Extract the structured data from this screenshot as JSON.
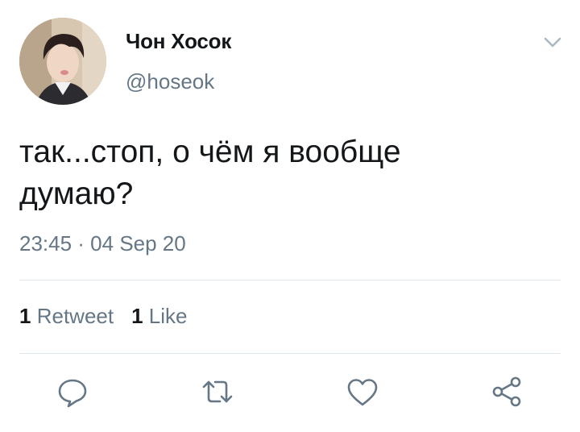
{
  "tweet": {
    "author": {
      "display_name": "Чон Хосок",
      "handle": "@hoseok"
    },
    "text": "так...стоп, о чём я вообще\nдумаю?",
    "timestamp": "23:45 · 04 Sep 20",
    "stats": {
      "retweets": {
        "count": "1",
        "label": "Retweet"
      },
      "likes": {
        "count": "1",
        "label": "Like"
      }
    }
  },
  "icons": {
    "menu": "chevron-down-icon",
    "reply": "reply-icon",
    "retweet": "retweet-icon",
    "like": "heart-icon",
    "share": "share-icon"
  },
  "colors": {
    "text": "#14171a",
    "secondary": "#657786",
    "divider": "#e1e8ed",
    "icon": "#657786"
  }
}
